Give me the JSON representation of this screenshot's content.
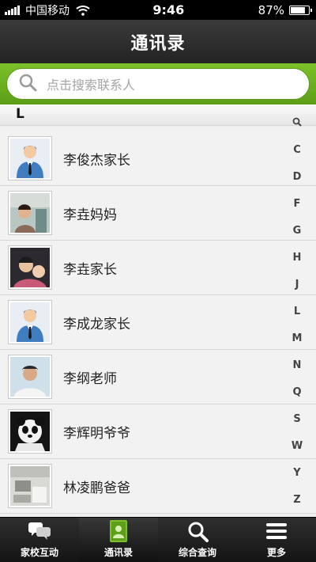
{
  "status": {
    "carrier": "中国移动",
    "time": "9:46",
    "battery": "87%",
    "battery_level": 0.87
  },
  "nav": {
    "title": "通讯录"
  },
  "search": {
    "placeholder": "点击搜索联系人"
  },
  "section": {
    "letter": "L"
  },
  "contacts": [
    {
      "name": "李俊杰家长",
      "avatar": "default-avatar-icon"
    },
    {
      "name": "李垚妈妈",
      "avatar": "photo-avatar"
    },
    {
      "name": "李垚家长",
      "avatar": "photo-avatar"
    },
    {
      "name": "李成龙家长",
      "avatar": "default-avatar-icon"
    },
    {
      "name": "李纲老师",
      "avatar": "photo-avatar"
    },
    {
      "name": "李辉明爷爷",
      "avatar": "photo-avatar"
    },
    {
      "name": "林凌鹏爸爸",
      "avatar": "photo-avatar"
    }
  ],
  "index": [
    "Q",
    "C",
    "D",
    "F",
    "G",
    "H",
    "J",
    "L",
    "M",
    "N",
    "Q",
    "S",
    "W",
    "Y",
    "Z"
  ],
  "tabs": [
    {
      "label": "家校互动",
      "icon": "chat-bubbles-icon"
    },
    {
      "label": "通讯录",
      "icon": "contacts-book-icon",
      "active": true
    },
    {
      "label": "综合查询",
      "icon": "search-icon"
    },
    {
      "label": "更多",
      "icon": "menu-icon"
    }
  ],
  "colors": {
    "accent_green": "#6db022",
    "nav_dark": "#2a2a2a"
  }
}
